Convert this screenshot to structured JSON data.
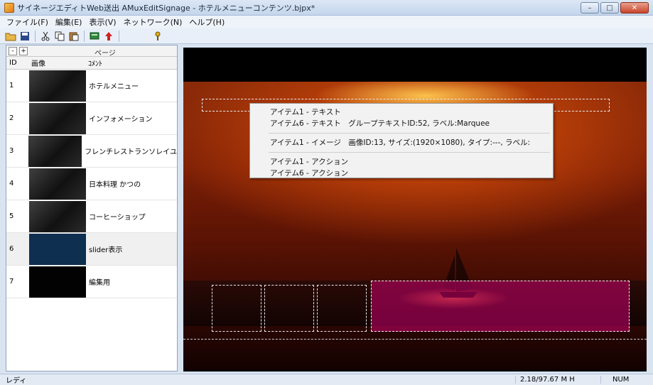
{
  "window": {
    "title": "サイネージエディトWeb送出 AMuxEditSignage - ホテルメニューコンテンツ.bjpx*",
    "controls": [
      "minimize-icon",
      "maximize-icon",
      "close-icon"
    ]
  },
  "menubar": {
    "items": [
      "ファイル(F)",
      "編集(E)",
      "表示(V)",
      "ネットワーク(N)",
      "ヘルプ(H)"
    ]
  },
  "toolbar": {
    "icons": [
      "open-folder-icon",
      "save-icon",
      "cut-icon",
      "copy-icon",
      "paste-icon",
      "send-icon",
      "upload-arrow-icon",
      "key-icon"
    ]
  },
  "pages_panel": {
    "collapse_label": "-",
    "expand_label": "+",
    "title": "ページ",
    "columns": {
      "id": "ID",
      "image": "画像",
      "comment": "ｺﾒﾝﾄ"
    },
    "rows": [
      {
        "id": "1",
        "comment": "ホテルメニュー"
      },
      {
        "id": "2",
        "comment": "インフォメーション"
      },
      {
        "id": "3",
        "comment": "フレンチレストランソレイユ"
      },
      {
        "id": "4",
        "comment": "日本料理 かつの"
      },
      {
        "id": "5",
        "comment": "コーヒーショップ"
      },
      {
        "id": "6",
        "comment": "slider表示"
      },
      {
        "id": "7",
        "comment": "編集用"
      }
    ]
  },
  "context_menu": {
    "group1": [
      "アイテム1 - テキスト",
      "アイテム6 - テキスト　グループテキストID:52, ラベル:Marquee"
    ],
    "group2": [
      "アイテム1 - イメージ　画像ID:13, サイズ:(1920×1080), タイプ:---, ラベル:"
    ],
    "group3": [
      "アイテム1 - アクション",
      "アイテム6 - アクション"
    ]
  },
  "statusbar": {
    "status": "レディ",
    "memory": "2.18/97.67 M  H",
    "num": "NUM"
  },
  "colors": {
    "selection_overlay": "#c8006e",
    "title_gradient_top": "#dce7f5"
  }
}
